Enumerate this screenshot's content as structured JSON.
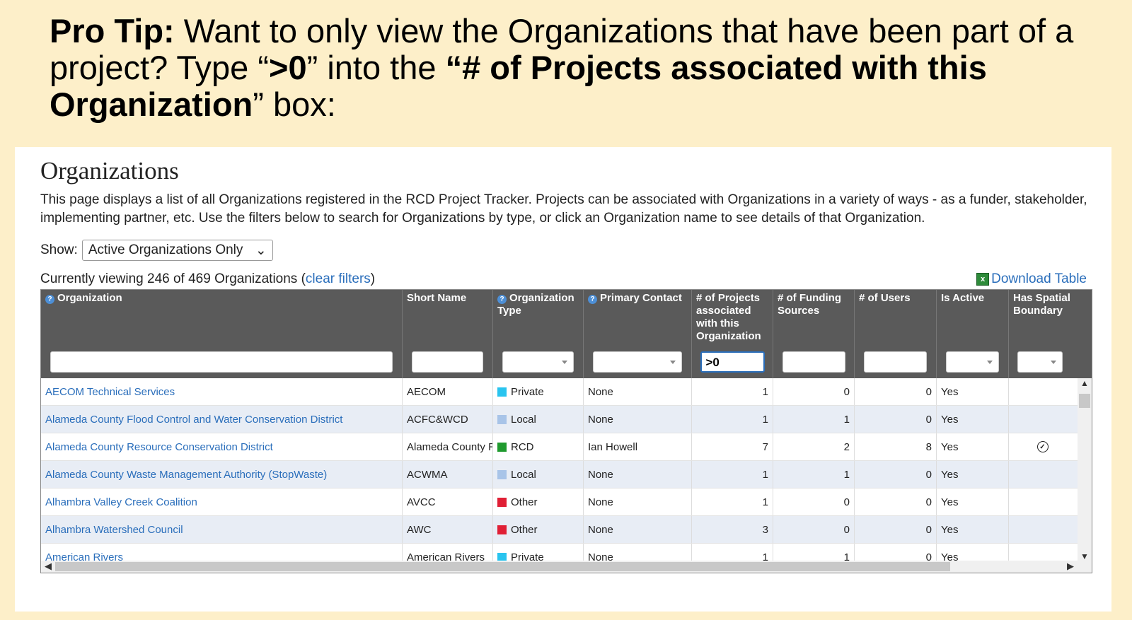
{
  "tip": {
    "p1_bold": "Pro Tip:",
    "p2": " Want to only view the Organizations that have been part of a project? Type “",
    "p3_bold": ">0",
    "p4": "” into the ",
    "p5_bold": "“# of Projects associated with this Organization",
    "p6": "” box:"
  },
  "page": {
    "title": "Organizations",
    "description": "This page displays a list of all Organizations registered in the RCD Project Tracker. Projects can be associated with Organizations in a variety of ways - as a funder, stakeholder, implementing partner, etc. Use the filters below to search for Organizations by type, or click an Organization name to see details of that Organization.",
    "show_label": "Show:",
    "show_value": "Active Organizations Only",
    "viewing_prefix": "Currently viewing 246 of 469 Organizations (",
    "clear_filters": "clear filters",
    "viewing_suffix": ")",
    "download": "Download Table"
  },
  "columns": [
    "Organization",
    "Short Name",
    "Organization Type",
    "Primary Contact",
    "# of Projects associated with this Organization",
    "# of Funding Sources",
    "# of Users",
    "Is Active",
    "Has Spatial Boundary"
  ],
  "filter_projects_value": ">0",
  "rows": [
    {
      "org": "AECOM Technical Services",
      "short": "AECOM",
      "type": "Private",
      "type_color": "#29c4ef",
      "contact": "None",
      "projects": "1",
      "funding": "0",
      "users": "0",
      "active": "Yes",
      "spatial": false
    },
    {
      "org": "Alameda County Flood Control and Water Conservation District",
      "short": "ACFC&WCD",
      "type": "Local",
      "type_color": "#a8c4e8",
      "contact": "None",
      "projects": "1",
      "funding": "1",
      "users": "0",
      "active": "Yes",
      "spatial": false
    },
    {
      "org": "Alameda County Resource Conservation District",
      "short": "Alameda County R",
      "type": "RCD",
      "type_color": "#1f9a2e",
      "contact": "Ian Howell",
      "projects": "7",
      "funding": "2",
      "users": "8",
      "active": "Yes",
      "spatial": true
    },
    {
      "org": "Alameda County Waste Management Authority (StopWaste)",
      "short": "ACWMA",
      "type": "Local",
      "type_color": "#a8c4e8",
      "contact": "None",
      "projects": "1",
      "funding": "1",
      "users": "0",
      "active": "Yes",
      "spatial": false
    },
    {
      "org": "Alhambra Valley Creek Coalition",
      "short": "AVCC",
      "type": "Other",
      "type_color": "#e01f35",
      "contact": "None",
      "projects": "1",
      "funding": "0",
      "users": "0",
      "active": "Yes",
      "spatial": false
    },
    {
      "org": "Alhambra Watershed Council",
      "short": "AWC",
      "type": "Other",
      "type_color": "#e01f35",
      "contact": "None",
      "projects": "3",
      "funding": "0",
      "users": "0",
      "active": "Yes",
      "spatial": false
    },
    {
      "org": "American Rivers",
      "short": "American Rivers",
      "type": "Private",
      "type_color": "#29c4ef",
      "contact": "None",
      "projects": "1",
      "funding": "1",
      "users": "0",
      "active": "Yes",
      "spatial": false
    }
  ]
}
